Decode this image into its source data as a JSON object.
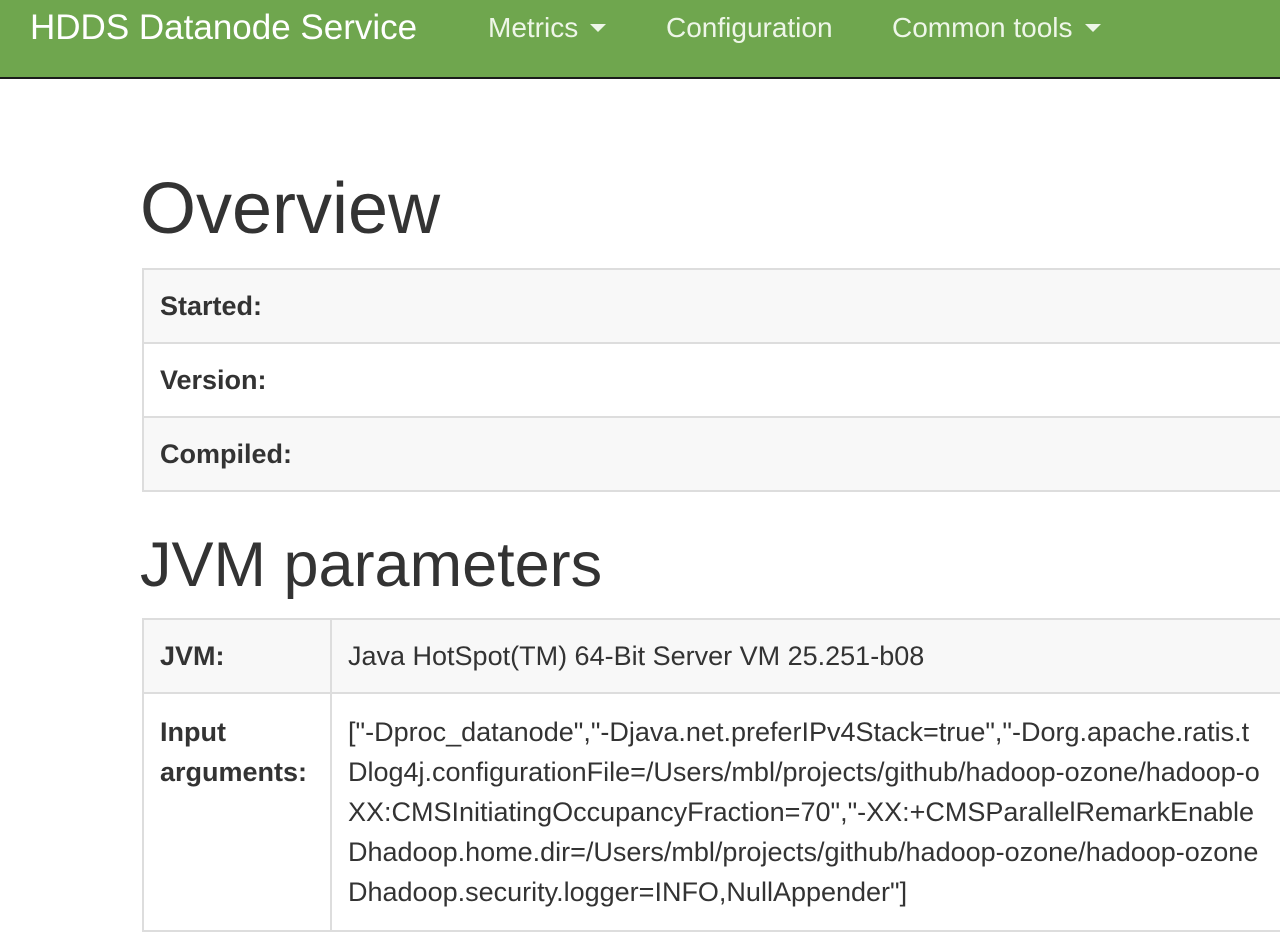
{
  "navbar": {
    "brand": "HDDS Datanode Service",
    "items": [
      {
        "label": "Metrics",
        "dropdown": true
      },
      {
        "label": "Configuration",
        "dropdown": false
      },
      {
        "label": "Common tools",
        "dropdown": true
      }
    ]
  },
  "overview": {
    "title": "Overview",
    "rows": [
      {
        "label": "Started:",
        "value": ""
      },
      {
        "label": "Version:",
        "value": ""
      },
      {
        "label": "Compiled:",
        "value": ""
      }
    ]
  },
  "jvm": {
    "title": "JVM parameters",
    "jvm_label": "JVM:",
    "jvm_value": "Java HotSpot(TM) 64-Bit Server VM 25.251-b08",
    "args_label": "Input arguments:",
    "args_lines": [
      "[\"-Dproc_datanode\",\"-Djava.net.preferIPv4Stack=true\",\"-Dorg.apache.ratis.t",
      "Dlog4j.configurationFile=/Users/mbl/projects/github/hadoop-ozone/hadoop-o",
      "XX:CMSInitiatingOccupancyFraction=70\",\"-XX:+CMSParallelRemarkEnable",
      "Dhadoop.home.dir=/Users/mbl/projects/github/hadoop-ozone/hadoop-ozone",
      "Dhadoop.security.logger=INFO,NullAppender\"]"
    ]
  },
  "colors": {
    "navbar_bg": "#6fa64e",
    "navbar_text": "#ffffff"
  }
}
